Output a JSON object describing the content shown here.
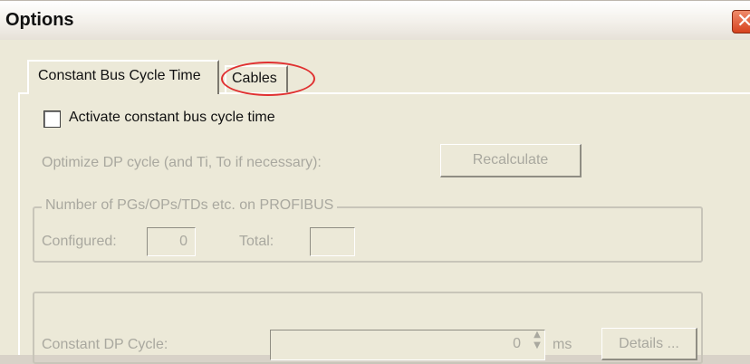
{
  "window": {
    "title": "Options",
    "close_glyph": "✕"
  },
  "tabs": [
    {
      "label": "Constant Bus Cycle Time",
      "active": true
    },
    {
      "label": "Cables",
      "active": false
    }
  ],
  "constant_bus": {
    "activate_label": "Activate constant bus cycle time",
    "activate_checked": false,
    "optimize_label": "Optimize DP cycle (and Ti, To if necessary):",
    "recalculate_label": "Recalculate",
    "pgs_group_title": "Number of PGs/OPs/TDs etc. on PROFIBUS",
    "configured_label": "Configured:",
    "configured_value": "0",
    "total_label": "Total:",
    "total_value": "",
    "dp_cycle_label": "Constant DP Cycle:",
    "dp_cycle_value": "0",
    "dp_cycle_unit": "ms",
    "details_label": "Details ..."
  },
  "colors": {
    "highlight_circle": "#e03030",
    "disabled_text": "#a9a89f"
  }
}
